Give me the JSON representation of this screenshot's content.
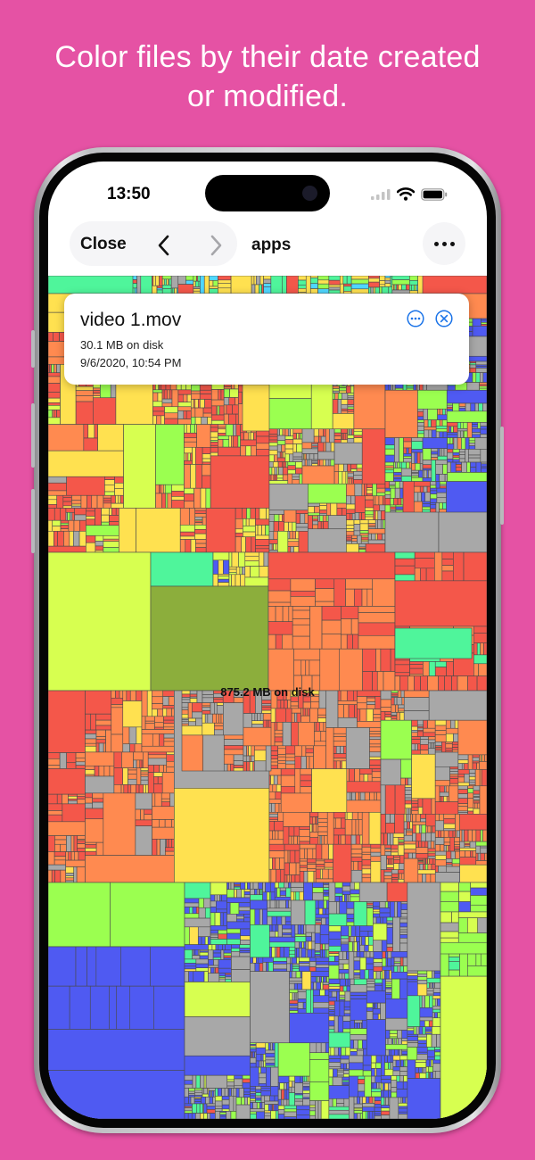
{
  "headline": {
    "line1": "Color files by their date created",
    "line2": "or modified."
  },
  "status_bar": {
    "time": "13:50",
    "icons": [
      "cellular-signal-icon",
      "wifi-icon",
      "battery-icon"
    ]
  },
  "toolbar": {
    "close_label": "Close",
    "back_icon": "chevron-left-icon",
    "forward_icon": "chevron-right-icon",
    "folder_title": "apps",
    "more_icon": "ellipsis-icon"
  },
  "info_card": {
    "file_name": "video 1.mov",
    "size": "30.1 MB on disk",
    "date": "9/6/2020, 10:54 PM",
    "more_icon": "ellipsis-circle-icon",
    "close_icon": "close-circle-icon"
  },
  "treemap": {
    "total_label": "875.2 MB on disk",
    "colors": {
      "orange": "#ff8a50",
      "red": "#f4574a",
      "yellow": "#ffe150",
      "lime": "#d7ff50",
      "green": "#9bff50",
      "mint": "#4ff59b",
      "olive": "#8cae3c",
      "blue": "#4f5af2",
      "gray": "#a8a8a8",
      "cyan": "#4fd7ff"
    }
  }
}
